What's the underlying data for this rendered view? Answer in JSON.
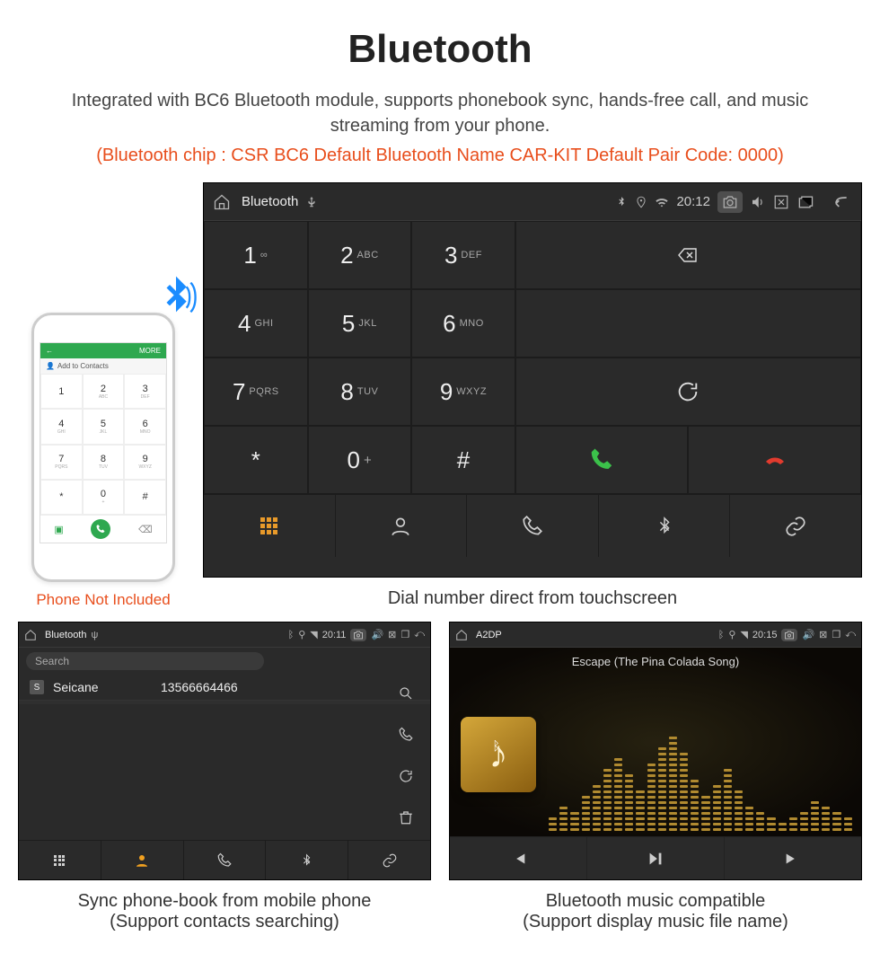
{
  "header": {
    "title": "Bluetooth",
    "subtitle": "Integrated with BC6 Bluetooth module, supports phonebook sync, hands-free call, and music streaming from your phone.",
    "orange_line": "(Bluetooth chip : CSR BC6    Default Bluetooth Name CAR-KIT    Default Pair Code: 0000)"
  },
  "phone": {
    "top_more": "MORE",
    "add_contacts": "Add to Contacts",
    "caption": "Phone Not Included",
    "keys": [
      {
        "n": "1",
        "s": ""
      },
      {
        "n": "2",
        "s": "ABC"
      },
      {
        "n": "3",
        "s": "DEF"
      },
      {
        "n": "4",
        "s": "GHI"
      },
      {
        "n": "5",
        "s": "JKL"
      },
      {
        "n": "6",
        "s": "MNO"
      },
      {
        "n": "7",
        "s": "PQRS"
      },
      {
        "n": "8",
        "s": "TUV"
      },
      {
        "n": "9",
        "s": "WXYZ"
      },
      {
        "n": "*",
        "s": ""
      },
      {
        "n": "0",
        "s": "+"
      },
      {
        "n": "#",
        "s": ""
      }
    ]
  },
  "main_screen": {
    "statusbar_title": "Bluetooth",
    "time": "20:12",
    "keys": [
      {
        "n": "1",
        "s": "∞"
      },
      {
        "n": "2",
        "s": "ABC"
      },
      {
        "n": "3",
        "s": "DEF"
      },
      {
        "n": "4",
        "s": "GHI"
      },
      {
        "n": "5",
        "s": "JKL"
      },
      {
        "n": "6",
        "s": "MNO"
      },
      {
        "n": "7",
        "s": "PQRS"
      },
      {
        "n": "8",
        "s": "TUV"
      },
      {
        "n": "9",
        "s": "WXYZ"
      },
      {
        "n": "*",
        "s": ""
      },
      {
        "n": "0",
        "s": "+",
        "plus": true
      },
      {
        "n": "#",
        "s": ""
      }
    ],
    "caption": "Dial number direct from touchscreen"
  },
  "contacts_screen": {
    "statusbar_title": "Bluetooth",
    "time": "20:11",
    "search_placeholder": "Search",
    "contact_badge": "S",
    "contact_name": "Seicane",
    "contact_number": "13566664466",
    "caption_l1": "Sync phone-book from mobile phone",
    "caption_l2": "(Support contacts searching)"
  },
  "music_screen": {
    "statusbar_title": "A2DP",
    "time": "20:15",
    "track": "Escape (The Pina Colada Song)",
    "caption_l1": "Bluetooth music compatible",
    "caption_l2": "(Support display music file name)"
  },
  "icons": {
    "home": "home-icon",
    "usb": "usb-icon",
    "bt": "bluetooth-icon",
    "loc": "location-icon",
    "wifi": "wifi-icon",
    "camera": "camera-icon",
    "volume": "volume-icon",
    "close": "close-box-icon",
    "windows": "windows-icon",
    "back": "back-icon",
    "backspace": "backspace-icon",
    "refresh": "refresh-icon",
    "call": "call-icon",
    "hangup": "hangup-icon",
    "grid": "grid-icon",
    "person": "person-icon",
    "phone": "phone-outline-icon",
    "link": "link-icon",
    "search": "search-icon",
    "prev": "prev-icon",
    "playpause": "playpause-icon",
    "next": "next-icon"
  }
}
